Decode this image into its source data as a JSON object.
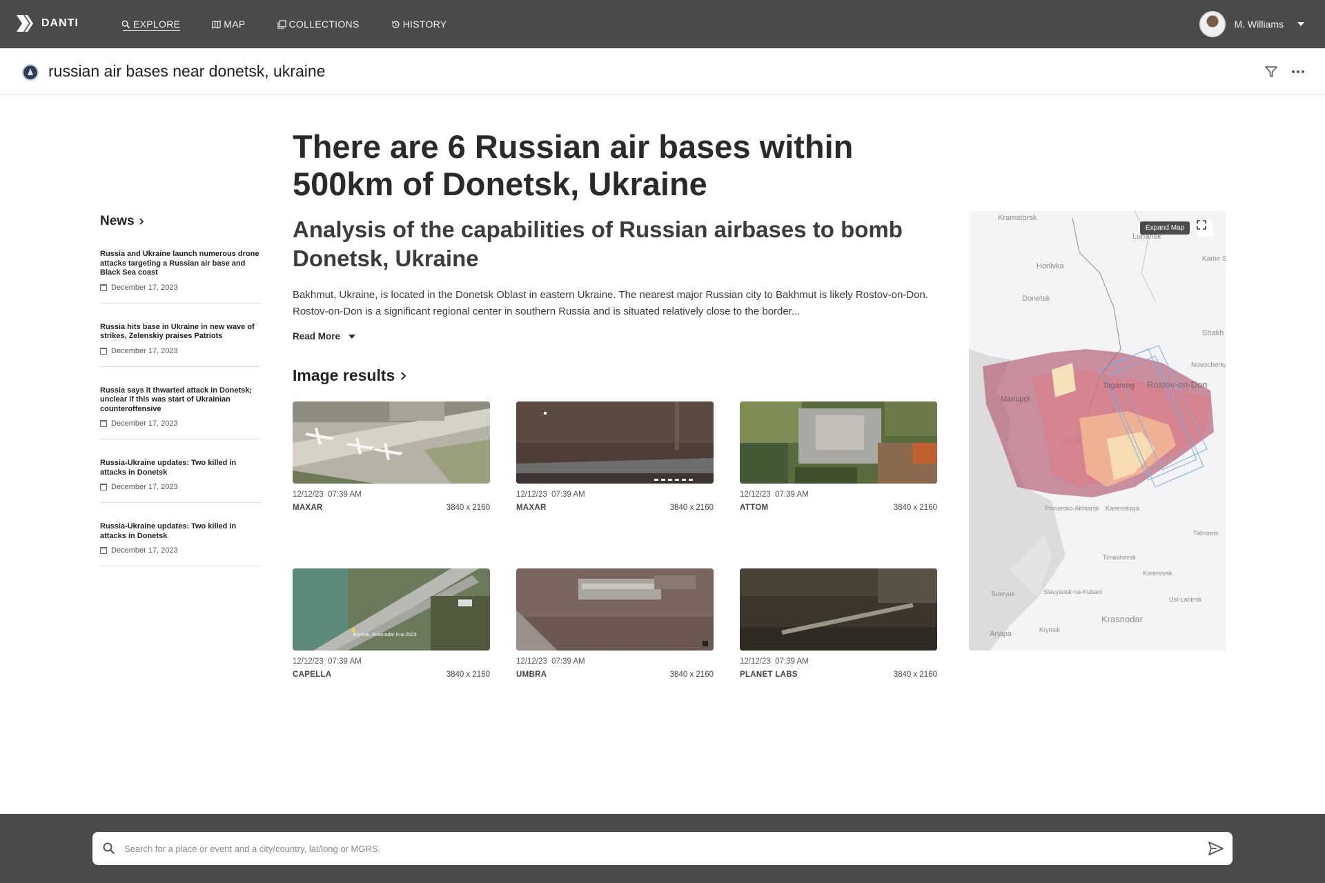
{
  "app": {
    "brand": "DANTI",
    "nav": [
      {
        "label": "EXPLORE",
        "icon": "search-icon"
      },
      {
        "label": "MAP",
        "icon": "map-icon"
      },
      {
        "label": "COLLECTIONS",
        "icon": "collections-icon"
      },
      {
        "label": "HISTORY",
        "icon": "history-icon"
      }
    ],
    "user": {
      "name": "M. Williams"
    }
  },
  "query": {
    "text": "russian air bases near donetsk, ukraine"
  },
  "news": {
    "heading": "News",
    "items": [
      {
        "title": "Russia and Ukraine launch numerous drone attacks targeting a Russian air base and Black Sea coast",
        "date": "December 17, 2023"
      },
      {
        "title": "Russia hits base in Ukraine in new wave of strikes, Zelenskiy praises Patriots",
        "date": "December 17, 2023"
      },
      {
        "title": "Russia says it thwarted attack in Donetsk; unclear if this was start of Ukrainian counteroffensive",
        "date": "December 17, 2023"
      },
      {
        "title": "Russia-Ukraine updates: Two killed in attacks in Donetsk",
        "date": "December 17, 2023"
      },
      {
        "title": "Russia-Ukraine updates: Two killed in attacks in Donetsk",
        "date": "December 17, 2023"
      }
    ]
  },
  "main": {
    "headline": "There are 6 Russian air bases within 500km of Donetsk, Ukraine",
    "subhead": "Analysis of the capabilities of Russian airbases to bomb Donetsk, Ukraine",
    "summary": "Bakhmut, Ukraine, is located in the Donetsk Oblast in eastern Ukraine. The nearest major Russian city to Bakhmut is likely Rostov-on-Don. Rostov-on-Don is a significant regional center in southern Russia and is situated relatively close to the border...",
    "read_more": "Read More",
    "image_results_heading": "Image results"
  },
  "images": [
    {
      "date": "12/12/23",
      "time": "07:39 AM",
      "source": "MAXAR",
      "resolution": "3840 x 2160"
    },
    {
      "date": "12/12/23",
      "time": "07:39 AM",
      "source": "MAXAR",
      "resolution": "3840 x 2160"
    },
    {
      "date": "12/12/23",
      "time": "07:39 AM",
      "source": "ATTOM",
      "resolution": "3840 x 2160"
    },
    {
      "date": "12/12/23",
      "time": "07:39 AM",
      "source": "CAPELLA",
      "resolution": "3840 x 2160",
      "overlay": "Krymsk, Krasnodar Krai 2023"
    },
    {
      "date": "12/12/23",
      "time": "07:39 AM",
      "source": "UMBRA",
      "resolution": "3840 x 2160"
    },
    {
      "date": "12/12/23",
      "time": "07:39 AM",
      "source": "PLANET LABS",
      "resolution": "3840 x 2160"
    }
  ],
  "map": {
    "expand_label": "Expand Map",
    "places": [
      "Kramatorsk",
      "Luhansk",
      "Horlivka",
      "Donetsk",
      "Kame Shakht",
      "Shakh",
      "Novocherka",
      "Mariupol",
      "Taganrog",
      "Rostov-on-Don",
      "Yeysk",
      "Primorsko-Akhtarsk",
      "Kanevskaya",
      "Tikhorets",
      "Timashevsk",
      "Korenovsk",
      "Temryuk",
      "Slavyansk-na-Kubani",
      "Ust-Labinsk",
      "Krasnodar",
      "Anapa",
      "Krymsk"
    ]
  },
  "search": {
    "placeholder": "Search for a place or event and a city/country, lat/long or MGRS."
  }
}
